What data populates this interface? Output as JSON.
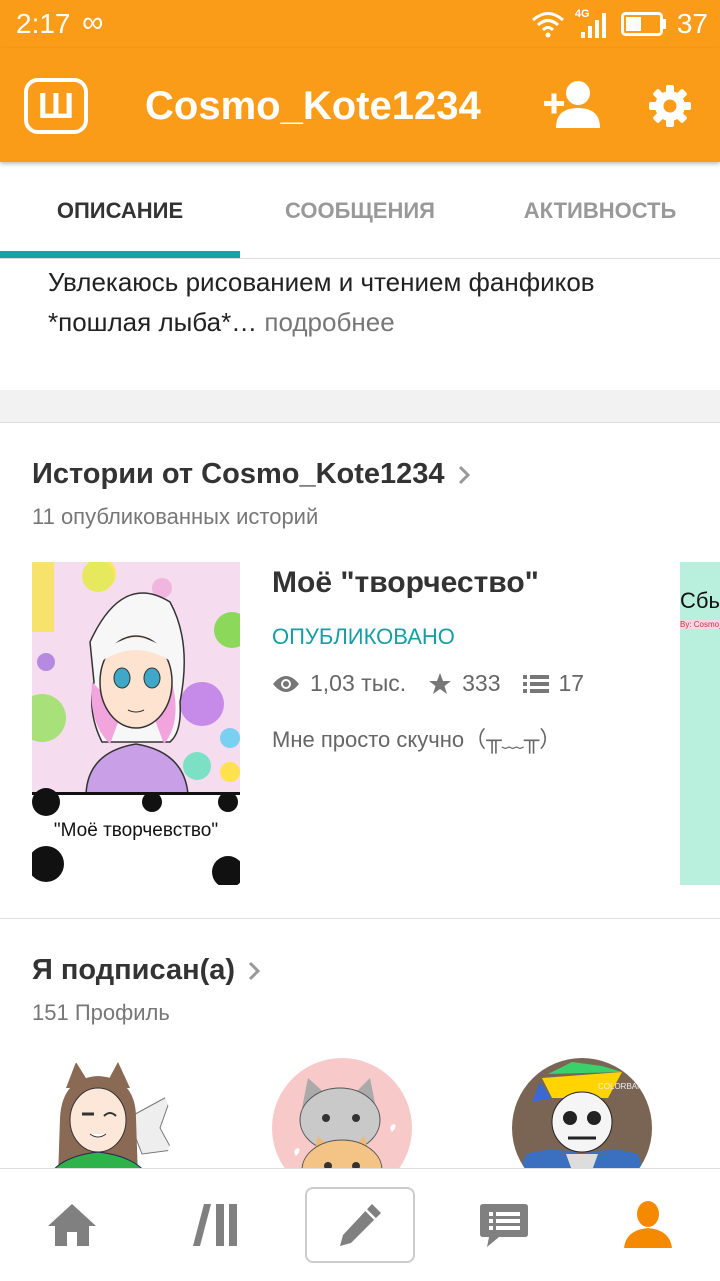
{
  "status_bar": {
    "time": "2:17",
    "infinity": "∞",
    "network": "4G",
    "battery": "37"
  },
  "app_bar": {
    "logo_letter": "Ш",
    "title": "Cosmo_Kote1234",
    "icons": [
      "add-friend-icon",
      "gear-icon"
    ]
  },
  "tabs": [
    {
      "label": "ОПИСАНИЕ",
      "active": true
    },
    {
      "label": "СООБЩЕНИЯ",
      "active": false
    },
    {
      "label": "АКТИВНОСТЬ",
      "active": false
    }
  ],
  "description": {
    "line1": "Увлекаюсь рисованием и чтением фанфиков",
    "line2": "*пошлая лыба*…",
    "more": "подробнее"
  },
  "stories": {
    "title": "Истории от Cosmo_Kote1234",
    "subtitle": "11 опубликованных историй",
    "items": [
      {
        "cover_caption": "\"Моё творчевство\"",
        "title": "Моё \"творчество\"",
        "status": "ОПУБЛИКОВАНО",
        "views": "1,03 тыс.",
        "votes": "333",
        "parts": "17",
        "description": "Мне просто скучно（╥﹏╥）"
      }
    ],
    "next_cover_text": "Сбь",
    "next_cover_small": "By: Cosmo_K"
  },
  "following": {
    "title": "Я подписан(а)",
    "subtitle": "151 Профиль",
    "avatar_badge": "COLORBAN"
  },
  "bottom_nav": [
    {
      "name": "home",
      "icon": "home-icon"
    },
    {
      "name": "library",
      "icon": "library-icon"
    },
    {
      "name": "write",
      "icon": "pencil-icon"
    },
    {
      "name": "messages",
      "icon": "messages-icon"
    },
    {
      "name": "profile",
      "icon": "profile-icon"
    }
  ],
  "colors": {
    "accent": "#fa9c17",
    "teal": "#19a2a6",
    "nav_active": "#f58a00"
  }
}
